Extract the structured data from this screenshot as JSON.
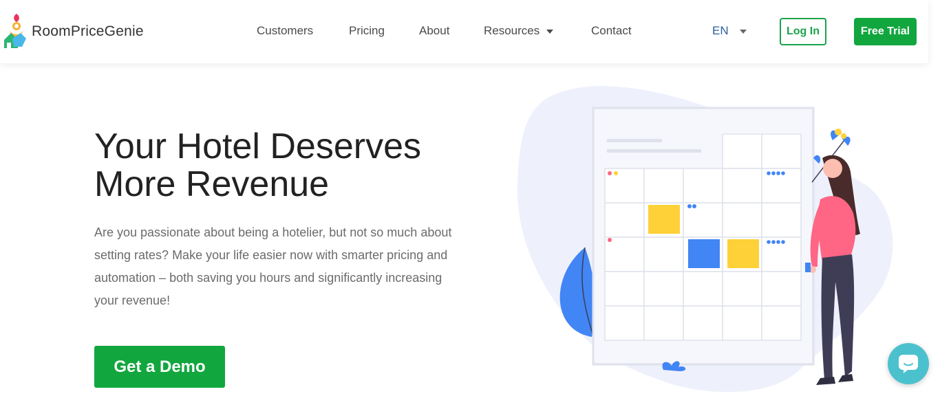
{
  "header": {
    "logo_text": "RoomPriceGenie",
    "nav": [
      {
        "label": "Customers"
      },
      {
        "label": "Pricing"
      },
      {
        "label": "About"
      },
      {
        "label": "Resources",
        "dropdown": true
      },
      {
        "label": "Contact"
      }
    ],
    "language": "EN",
    "login_label": "Log In",
    "trial_label": "Free Trial"
  },
  "hero": {
    "title_line1": "Your Hotel Deserves",
    "title_line2": "More Revenue",
    "description": "Are you passionate about being a hotelier, but not so much about setting rates? Make your life easier now with smarter pricing and automation – both saving you hours and significantly increasing your revenue!",
    "cta_label": "Get a Demo"
  },
  "colors": {
    "brand_green": "#12a63e",
    "link_blue": "#2a5f9e",
    "chat_teal": "#4cc1ce",
    "accent_yellow": "#ffd139",
    "accent_blue": "#4285f4",
    "accent_pink": "#ff6584"
  },
  "icons": {
    "logo": "genie-logo-icon",
    "chat": "chat-bubble-icon",
    "dropdown": "chevron-down-icon"
  }
}
